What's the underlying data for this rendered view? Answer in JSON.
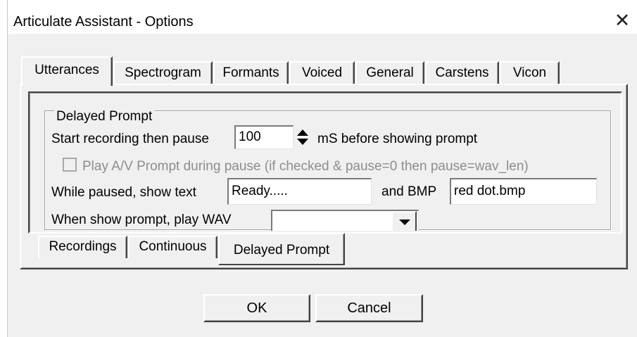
{
  "window": {
    "title": "Articulate Assistant - Options",
    "close_glyph": "✕"
  },
  "tabs": [
    "Utterances",
    "Spectrogram",
    "Formants",
    "Voiced",
    "General",
    "Carstens",
    "Vicon"
  ],
  "active_tab": "Utterances",
  "group": {
    "legend": "Delayed Prompt",
    "start_label": "Start recording then pause",
    "pause_value": "100",
    "pause_suffix": "mS before showing prompt",
    "play_av_label": "Play A/V Prompt during pause (if checked  & pause=0 then  pause=wav_len)",
    "play_av_checked": false,
    "while_paused_label": "While paused, show text",
    "paused_text_value": "Ready.....",
    "and_bmp_label": "and BMP",
    "bmp_value": "red dot.bmp",
    "wav_label": "When show prompt, play WAV",
    "wav_value": ""
  },
  "subtabs": [
    "Recordings",
    "Continuous",
    "Delayed Prompt"
  ],
  "active_subtab": "Delayed Prompt",
  "buttons": {
    "ok": "OK",
    "cancel": "Cancel"
  },
  "icons": {
    "close": "close-icon",
    "spin_up": "spin-up-icon",
    "spin_down": "spin-down-icon",
    "dropdown": "chevron-down-icon"
  }
}
